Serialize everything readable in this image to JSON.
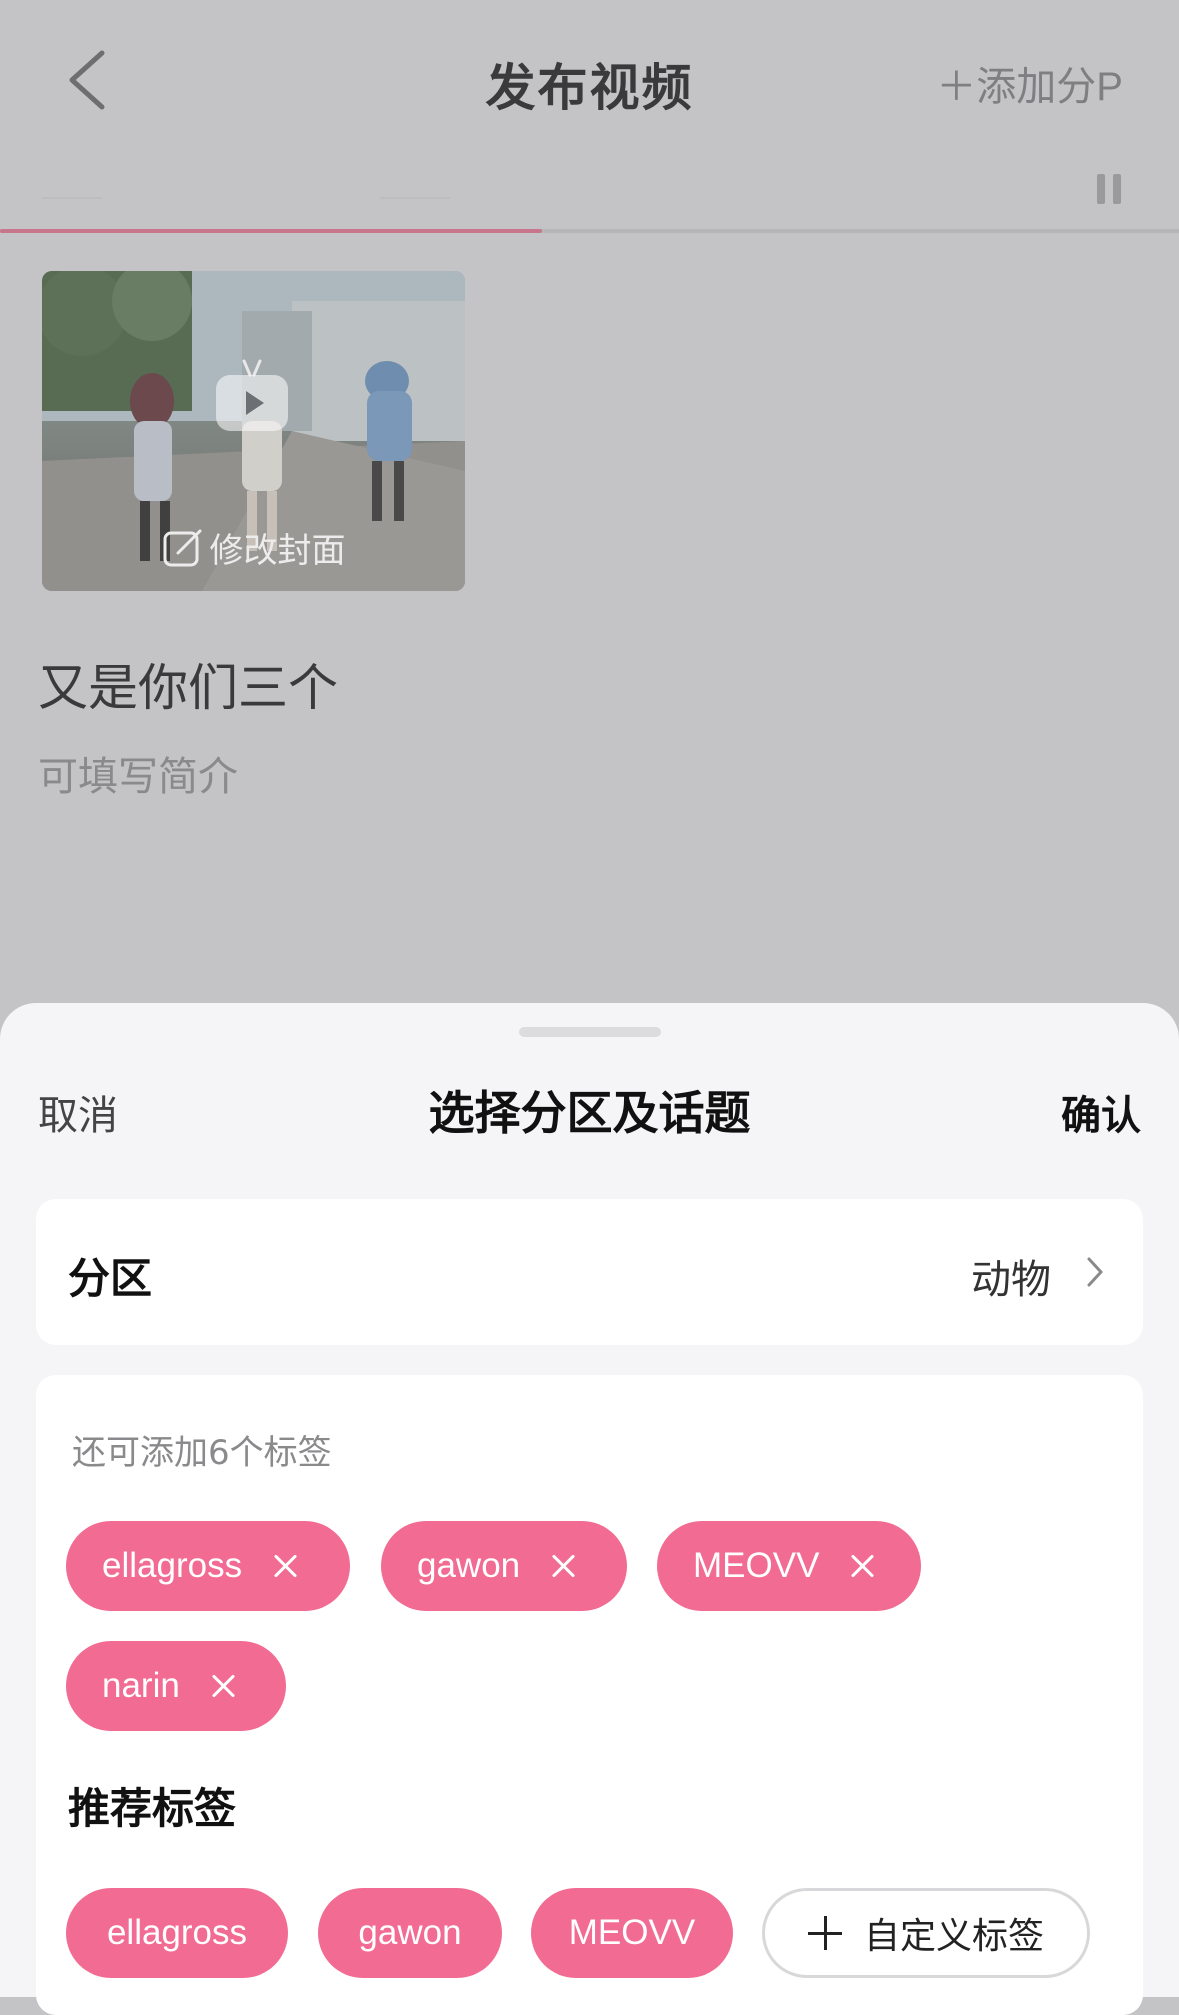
{
  "header": {
    "title": "发布视频",
    "add_part_label": "＋添加分P"
  },
  "upload": {
    "progress_fraction": 0.46
  },
  "video": {
    "edit_cover_label": "修改封面",
    "title": "又是你们三个",
    "description_placeholder": "可填写简介"
  },
  "sheet": {
    "cancel_label": "取消",
    "title": "选择分区及话题",
    "confirm_label": "确认",
    "category": {
      "label": "分区",
      "value": "动物"
    },
    "tags": {
      "hint": "还可添加6个标签",
      "selected": [
        "ellagross",
        "gawon",
        "MEOVV",
        "narin"
      ],
      "recommended_title": "推荐标签",
      "recommended": [
        "ellagross",
        "gawon",
        "MEOVV"
      ],
      "custom_label": "自定义标签"
    }
  },
  "colors": {
    "accent": "#f26b92",
    "progress": "#c7768c"
  }
}
